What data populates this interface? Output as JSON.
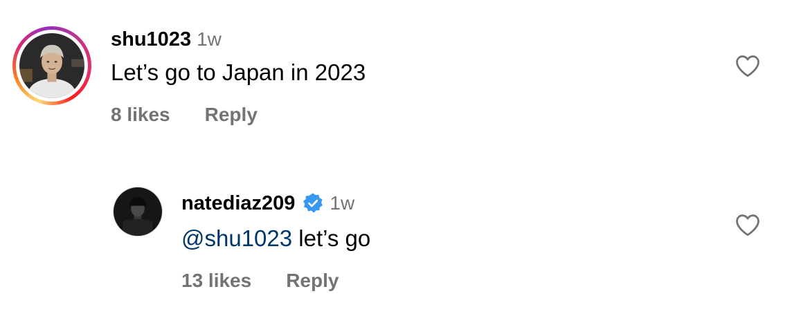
{
  "comments": [
    {
      "username": "shu1023",
      "time": "1w",
      "text": "Let’s go to Japan in 2023",
      "likes": "8 likes",
      "reply_label": "Reply",
      "has_story_ring": true,
      "icons": {
        "like": "heart-outline-icon"
      }
    }
  ],
  "replies": [
    {
      "username": "natediaz209",
      "verified": true,
      "time": "1w",
      "mention": "@shu1023",
      "text": " let’s go",
      "likes": "13 likes",
      "reply_label": "Reply",
      "icons": {
        "verified": "verified-badge-icon",
        "like": "heart-outline-icon"
      }
    }
  ],
  "colors": {
    "secondary_text": "#737373",
    "mention": "#00376b",
    "verified_blue": "#3897f0"
  }
}
